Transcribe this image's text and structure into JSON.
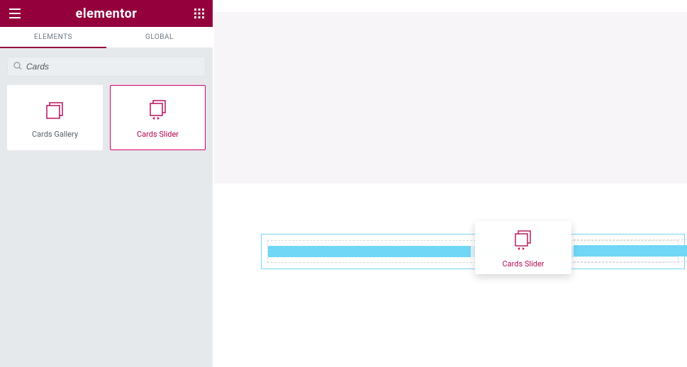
{
  "brand": "elementor",
  "tabs": {
    "elements": "ELEMENTS",
    "global": "GLOBAL",
    "active": "elements"
  },
  "search": {
    "placeholder": "Cards",
    "value": "Cards"
  },
  "widgets": [
    {
      "id": "cards-gallery",
      "label": "Cards Gallery",
      "selected": false
    },
    {
      "id": "cards-slider",
      "label": "Cards Slider",
      "selected": true
    }
  ],
  "drag": {
    "label": "Cards Slider"
  },
  "colors": {
    "accent": "#93003c",
    "accent_bright": "#d5006a",
    "drop_target": "#71d7f7"
  }
}
